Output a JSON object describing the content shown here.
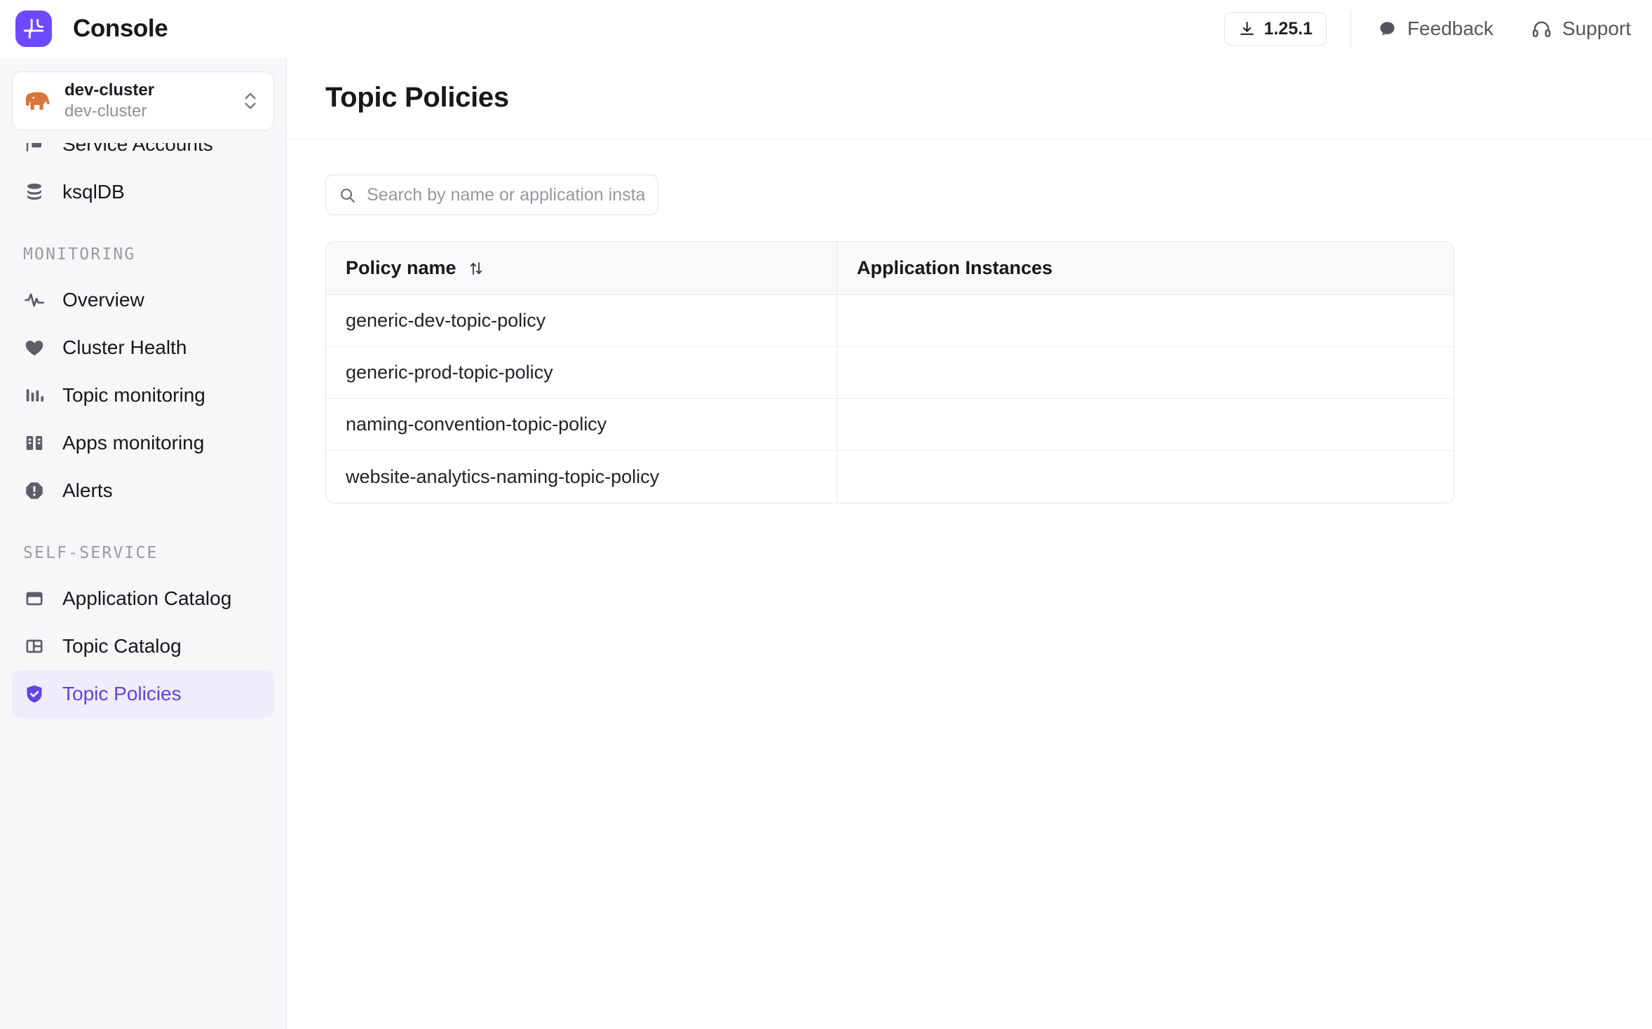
{
  "header": {
    "logo_icon": "branch-path-logo-icon",
    "title": "Console",
    "version_label": "1.25.1",
    "version_icon": "download-icon",
    "feedback_label": "Feedback",
    "feedback_icon": "speech-bubble-icon",
    "support_label": "Support",
    "support_icon": "headphones-icon"
  },
  "sidebar": {
    "cluster": {
      "icon": "elephant-icon",
      "name": "dev-cluster",
      "subtitle": "dev-cluster",
      "caret_icon": "chevron-up-down-icon"
    },
    "items": [
      {
        "label": "Service Accounts",
        "icon": "service-accounts-icon",
        "active": false,
        "clipped": true
      },
      {
        "label": "ksqlDB",
        "icon": "database-icon",
        "active": false
      },
      {
        "label": "Overview",
        "icon": "activity-pulse-icon",
        "active": false
      },
      {
        "label": "Cluster Health",
        "icon": "heart-icon",
        "active": false
      },
      {
        "label": "Topic monitoring",
        "icon": "bar-chart-icon",
        "active": false
      },
      {
        "label": "Apps monitoring",
        "icon": "apps-grid-icon",
        "active": false
      },
      {
        "label": "Alerts",
        "icon": "alert-octagon-icon",
        "active": false
      },
      {
        "label": "Application Catalog",
        "icon": "window-icon",
        "active": false
      },
      {
        "label": "Topic Catalog",
        "icon": "layout-panels-icon",
        "active": false
      },
      {
        "label": "Topic Policies",
        "icon": "shield-check-icon",
        "active": true
      }
    ],
    "sections": {
      "monitoring": "MONITORING",
      "self_service": "SELF-SERVICE"
    }
  },
  "main": {
    "page_title": "Topic Policies",
    "search": {
      "icon": "search-icon",
      "placeholder": "Search by name or application instance",
      "value": ""
    },
    "table": {
      "columns": [
        {
          "label": "Policy name",
          "sortable": true,
          "sort_icon": "sort-arrows-icon"
        },
        {
          "label": "Application Instances",
          "sortable": false
        }
      ],
      "rows": [
        {
          "policy_name": "generic-dev-topic-policy",
          "application_instances": ""
        },
        {
          "policy_name": "generic-prod-topic-policy",
          "application_instances": ""
        },
        {
          "policy_name": "naming-convention-topic-policy",
          "application_instances": ""
        },
        {
          "policy_name": "website-analytics-naming-topic-policy",
          "application_instances": ""
        }
      ]
    }
  },
  "colors": {
    "brand_purple": "#6d4aff",
    "active_nav_bg": "#efecfe",
    "active_nav_text": "#6244e0",
    "sidebar_bg": "#f7f7f9",
    "elephant_orange": "#d9743a",
    "table_header_bg": "#f9f9fb"
  }
}
